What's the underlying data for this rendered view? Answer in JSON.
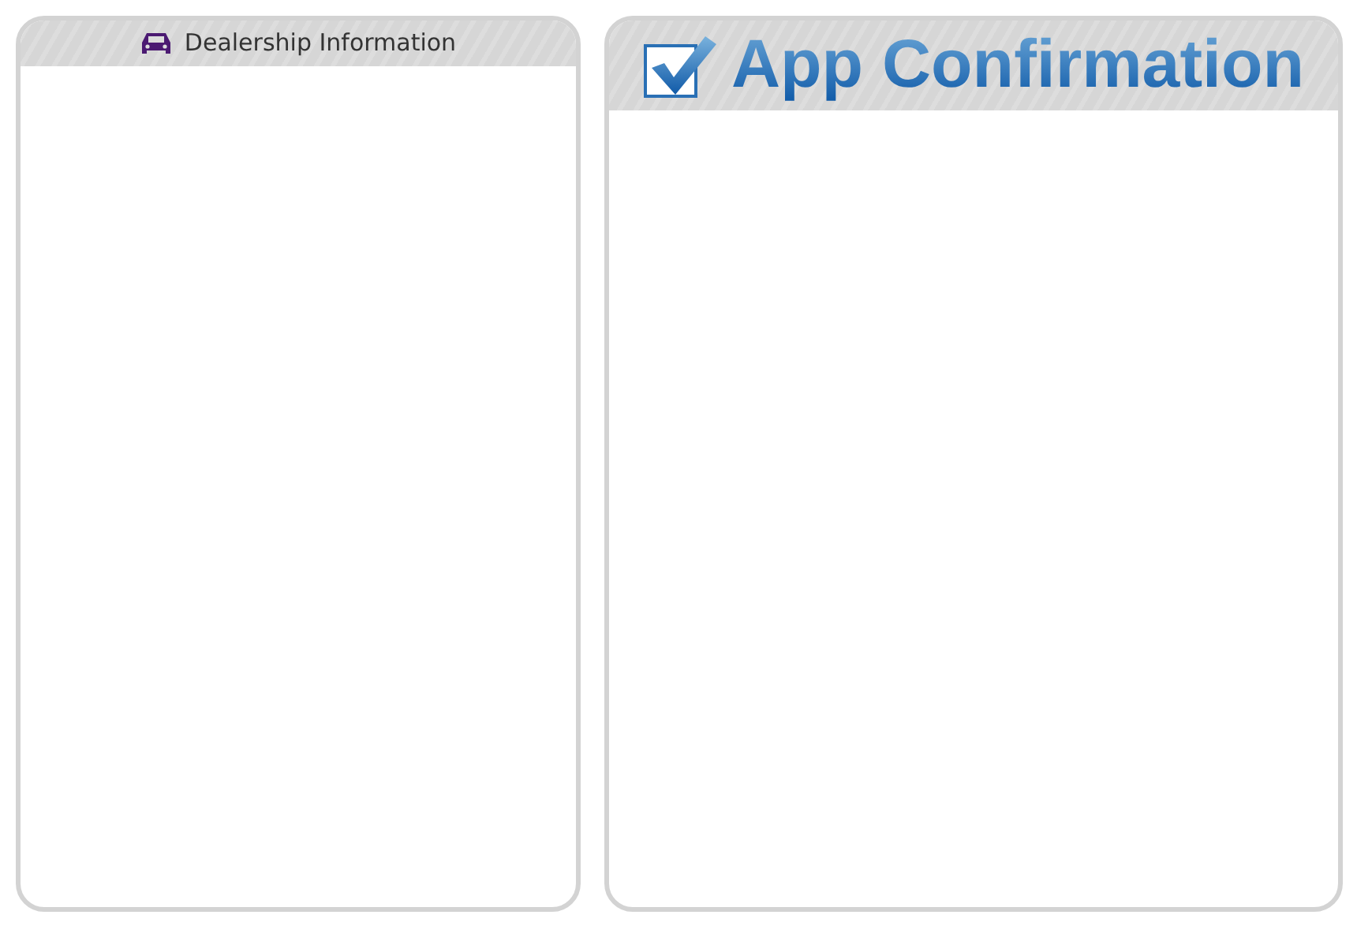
{
  "panels": [
    {
      "kind": "small",
      "title": "Dealership Information"
    },
    {
      "kind": "large",
      "title": "App Confirmation"
    }
  ]
}
